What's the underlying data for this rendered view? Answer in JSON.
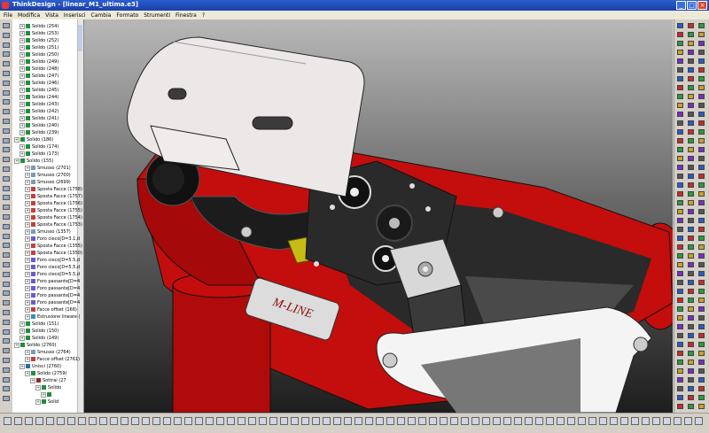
{
  "window": {
    "title": "ThinkDesign - [linear_M1_ultima.e3]"
  },
  "menu": [
    {
      "label": "File"
    },
    {
      "label": "Modifica"
    },
    {
      "label": "Vista"
    },
    {
      "label": "Inserisci"
    },
    {
      "label": "Cambia"
    },
    {
      "label": "Formato"
    },
    {
      "label": "Strumenti"
    },
    {
      "label": "Finestra"
    },
    {
      "label": "?"
    }
  ],
  "tree": {
    "items": [
      {
        "label": "Solido (254)",
        "indent": 1,
        "icon": "solid"
      },
      {
        "label": "Solido (253)",
        "indent": 1,
        "icon": "solid"
      },
      {
        "label": "Solido (252)",
        "indent": 1,
        "icon": "solid"
      },
      {
        "label": "Solido (251)",
        "indent": 1,
        "icon": "solid"
      },
      {
        "label": "Solido (250)",
        "indent": 1,
        "icon": "solid"
      },
      {
        "label": "Solido (249)",
        "indent": 1,
        "icon": "solid"
      },
      {
        "label": "Solido (248)",
        "indent": 1,
        "icon": "solid"
      },
      {
        "label": "Solido (247)",
        "indent": 1,
        "icon": "solid"
      },
      {
        "label": "Solido (246)",
        "indent": 1,
        "icon": "solid"
      },
      {
        "label": "Solido (245)",
        "indent": 1,
        "icon": "solid"
      },
      {
        "label": "Solido (244)",
        "indent": 1,
        "icon": "solid"
      },
      {
        "label": "Solido (243)",
        "indent": 1,
        "icon": "solid"
      },
      {
        "label": "Solido (242)",
        "indent": 1,
        "icon": "solid"
      },
      {
        "label": "Solido (241)",
        "indent": 1,
        "icon": "solid"
      },
      {
        "label": "Solido (240)",
        "indent": 1,
        "icon": "solid"
      },
      {
        "label": "Solido (239)",
        "indent": 1,
        "icon": "solid"
      },
      {
        "label": "Solido (186)",
        "indent": 0,
        "icon": "solid"
      },
      {
        "label": "Solido (174)",
        "indent": 1,
        "icon": "solid"
      },
      {
        "label": "Solido (173)",
        "indent": 1,
        "icon": "solid"
      },
      {
        "label": "Solido (155)",
        "indent": 0,
        "icon": "solid"
      },
      {
        "label": "Smusso (2701)",
        "indent": 2,
        "icon": "chamfer"
      },
      {
        "label": "Smusso (2700)",
        "indent": 2,
        "icon": "chamfer"
      },
      {
        "label": "Smusso (2699)",
        "indent": 2,
        "icon": "chamfer"
      },
      {
        "label": "Sposta Facce (1758)",
        "indent": 2,
        "icon": "face"
      },
      {
        "label": "Sposta Facce (1757)",
        "indent": 2,
        "icon": "face"
      },
      {
        "label": "Sposta Facce (1756)",
        "indent": 2,
        "icon": "face"
      },
      {
        "label": "Sposta Facce (1755)",
        "indent": 2,
        "icon": "face"
      },
      {
        "label": "Sposta Facce (1754)",
        "indent": 2,
        "icon": "face"
      },
      {
        "label": "Sposta Facce (1753)",
        "indent": 2,
        "icon": "face"
      },
      {
        "label": "Smusso (1357)",
        "indent": 2,
        "icon": "chamfer"
      },
      {
        "label": "Foro cieco[D=3.1,d",
        "indent": 2,
        "icon": "hole"
      },
      {
        "label": "Sposta Facce (1355)",
        "indent": 2,
        "icon": "face"
      },
      {
        "label": "Sposta Facce (1350)",
        "indent": 2,
        "icon": "face"
      },
      {
        "label": "Foro cieco[D=5.5,d",
        "indent": 2,
        "icon": "hole"
      },
      {
        "label": "Foro cieco[D=5.5,d",
        "indent": 2,
        "icon": "hole"
      },
      {
        "label": "Foro cieco[D=5.5,d",
        "indent": 2,
        "icon": "hole"
      },
      {
        "label": "Foro passante[D=4",
        "indent": 2,
        "icon": "hole"
      },
      {
        "label": "Foro passante[D=4",
        "indent": 2,
        "icon": "hole"
      },
      {
        "label": "Foro passante[D=4",
        "indent": 2,
        "icon": "hole"
      },
      {
        "label": "Foro passante[D=4",
        "indent": 2,
        "icon": "hole"
      },
      {
        "label": "Facce offset (166)",
        "indent": 2,
        "icon": "face"
      },
      {
        "label": "Estrusione lineare (",
        "indent": 2,
        "icon": "extrude"
      },
      {
        "label": "Solido (151)",
        "indent": 1,
        "icon": "solid"
      },
      {
        "label": "Solido (150)",
        "indent": 1,
        "icon": "solid"
      },
      {
        "label": "Solido (149)",
        "indent": 1,
        "icon": "solid"
      },
      {
        "label": "Solido (2760)",
        "indent": 0,
        "icon": "solid"
      },
      {
        "label": "Smusso (2764)",
        "indent": 2,
        "icon": "chamfer"
      },
      {
        "label": "Facce offset (2761)",
        "indent": 2,
        "icon": "face"
      },
      {
        "label": "Unisci (2760)",
        "indent": 1,
        "icon": "union"
      },
      {
        "label": "Solido (2759)",
        "indent": 2,
        "icon": "solid"
      },
      {
        "label": "Sottrai (27",
        "indent": 3,
        "icon": "subtract"
      },
      {
        "label": "Solido",
        "indent": 4,
        "icon": "solid"
      },
      {
        "label": "",
        "indent": 5,
        "icon": "dot"
      },
      {
        "label": "Solid",
        "indent": 4,
        "icon": "solid"
      }
    ]
  },
  "logo": {
    "text": "M-LINE"
  },
  "colors": {
    "body_red": "#c40d0d",
    "plate": "#ece8e8",
    "dark_part": "#2a2a2a",
    "yellow_belt": "#c7bb16",
    "tree_solid_icon": "#1f8f3a",
    "titlebar_blue": "#1f4fc0"
  }
}
